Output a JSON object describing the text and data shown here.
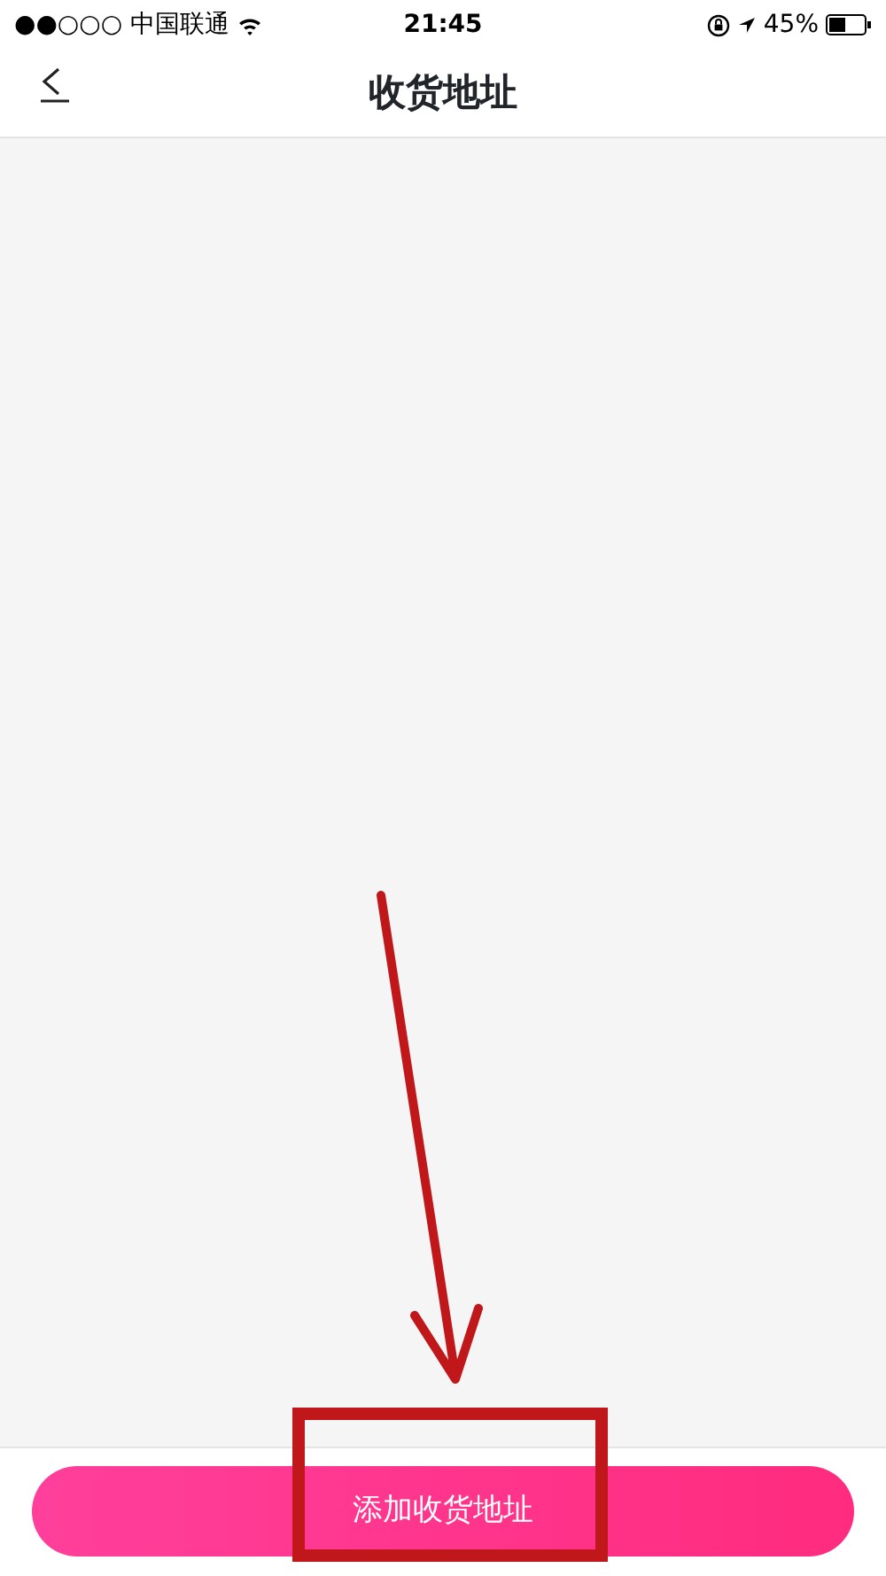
{
  "status_bar": {
    "carrier": "●●○○○ 中国联通",
    "time": "21:45",
    "battery": "45%"
  },
  "header": {
    "title": "收货地址"
  },
  "footer": {
    "button": "添加收货地址"
  }
}
